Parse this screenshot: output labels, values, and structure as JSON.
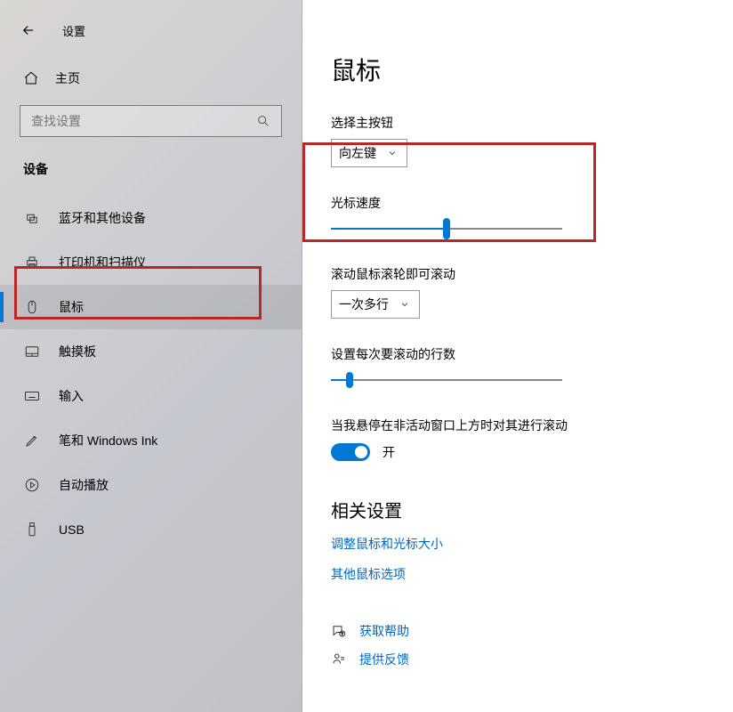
{
  "app": {
    "title": "设置"
  },
  "sidebar": {
    "home": "主页",
    "search_placeholder": "查找设置",
    "category": "设备",
    "items": [
      {
        "id": "bluetooth",
        "label": "蓝牙和其他设备"
      },
      {
        "id": "printers",
        "label": "打印机和扫描仪"
      },
      {
        "id": "mouse",
        "label": "鼠标"
      },
      {
        "id": "touchpad",
        "label": "触摸板"
      },
      {
        "id": "typing",
        "label": "输入"
      },
      {
        "id": "pen",
        "label": "笔和 Windows Ink"
      },
      {
        "id": "autoplay",
        "label": "自动播放"
      },
      {
        "id": "usb",
        "label": "USB"
      }
    ]
  },
  "main": {
    "title": "鼠标",
    "primary_button": {
      "label": "选择主按钮",
      "value": "向左键"
    },
    "cursor_speed": {
      "label": "光标速度",
      "value_pct": 50
    },
    "scroll_mode": {
      "label": "滚动鼠标滚轮即可滚动",
      "value": "一次多行"
    },
    "lines_per_scroll": {
      "label": "设置每次要滚动的行数",
      "value_pct": 8
    },
    "inactive_scroll": {
      "label": "当我悬停在非活动窗口上方时对其进行滚动",
      "state": "开",
      "on": true
    },
    "related": {
      "title": "相关设置",
      "link1": "调整鼠标和光标大小",
      "link2": "其他鼠标选项"
    },
    "help": {
      "get_help": "获取帮助",
      "feedback": "提供反馈"
    }
  },
  "colors": {
    "accent": "#0078d4",
    "highlight": "#b72826"
  }
}
